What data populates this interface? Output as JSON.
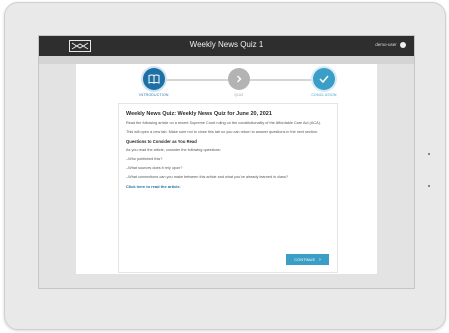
{
  "app": {
    "title": "Weekly News Quiz 1",
    "user": "demo-user"
  },
  "steps": [
    {
      "label": "INTRODUCTION"
    },
    {
      "label": "QUIZ"
    },
    {
      "label": "CONCLUSION"
    }
  ],
  "content": {
    "heading": "Weekly News Quiz: Weekly News Quiz for June 20, 2021",
    "p1": "Read the following article on a recent Supreme Court ruling on the constitutionality of the Affordable Care Act (ACA).",
    "p2": "This will open a new tab. Make sure not to close this tab so you can return to answer questions in the next section.",
    "subheading": "Questions to Consider as You Read",
    "intro": "As you read the article, consider the following questions:",
    "q1": "–Who published this?",
    "q2": "–What sources does it rely upon?",
    "q3": "–What connections can you make between this article and what you've already learned in class?",
    "link": "Click here to read the article.",
    "continue": "CONTINUE"
  },
  "colors": {
    "accent": "#3a9ec6",
    "active_step": "#1d6fa5",
    "topbar": "#2e2e2e"
  }
}
